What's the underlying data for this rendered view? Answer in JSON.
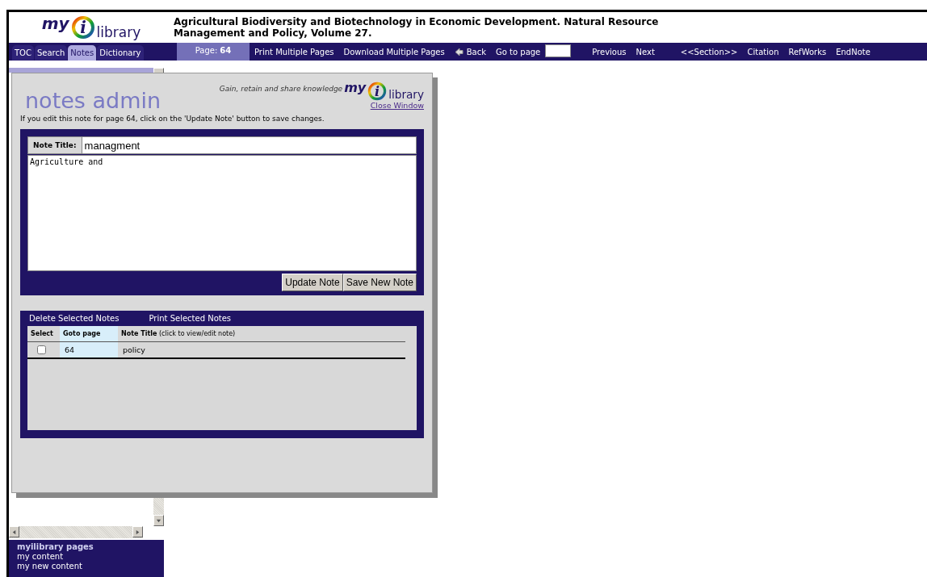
{
  "header": {
    "logo": {
      "prefix": "my",
      "letter": "i",
      "suffix": "library"
    },
    "title": "Agricultural Biodiversity and Biotechnology in Economic Development. Natural Resource Management and Policy, Volume 27."
  },
  "tabs": [
    {
      "label": "TOC",
      "selected": false
    },
    {
      "label": "Search",
      "selected": false
    },
    {
      "label": "Notes",
      "selected": true
    },
    {
      "label": "Dictionary",
      "selected": false
    }
  ],
  "page_indicator": {
    "label": "Page:",
    "value": "64"
  },
  "nav_links": [
    {
      "label": "Print Multiple Pages",
      "kind": "link"
    },
    {
      "label": "Download Multiple Pages",
      "kind": "link"
    },
    {
      "label": "Back",
      "kind": "back"
    },
    {
      "label": "Go to page",
      "kind": "goto"
    },
    {
      "label": "Previous",
      "kind": "link"
    },
    {
      "label": "Next",
      "kind": "link"
    },
    {
      "label": "<<Section>>",
      "kind": "link"
    },
    {
      "label": "Citation",
      "kind": "link"
    },
    {
      "label": "RefWorks",
      "kind": "link"
    },
    {
      "label": "EndNote",
      "kind": "link"
    }
  ],
  "sidebar": {
    "heading": "myilibrary pages",
    "items": [
      "my content",
      "my new content"
    ]
  },
  "notes_window": {
    "title": "notes admin",
    "tagline": "Gain, retain and share knowledge",
    "logo": {
      "prefix": "my",
      "letter": "i",
      "suffix": "library"
    },
    "close_link": "Close Window",
    "instruction": "If you edit this note for page 64, click on the 'Update Note' button to save changes.",
    "form": {
      "title_label": "Note Title:",
      "title_value": "managment",
      "body_value": "Agriculture and",
      "buttons": [
        "Update Note",
        "Save New Note"
      ]
    },
    "list": {
      "actions": [
        "Delete Selected Notes",
        "Print Selected Notes"
      ],
      "columns": [
        {
          "label": "Select"
        },
        {
          "label": "Goto page"
        },
        {
          "label": "**Note Title** (click to view/edit note)"
        }
      ],
      "rows": [
        {
          "checked": false,
          "page": "64",
          "title": "policy"
        }
      ]
    }
  }
}
